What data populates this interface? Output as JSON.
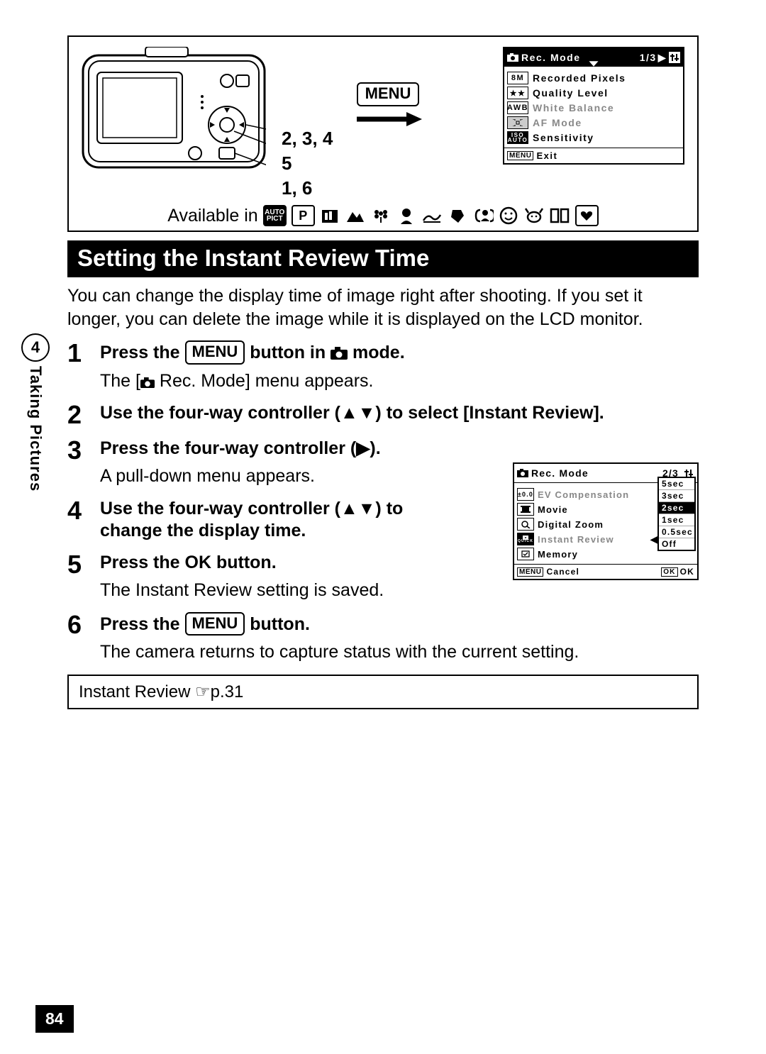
{
  "section": {
    "number": "4",
    "label": "Taking Pictures"
  },
  "pageNumber": "84",
  "figure": {
    "cameraLabels": {
      "l1": "2, 3, 4",
      "l2": "5",
      "l3": "1, 6"
    },
    "menuLabel": "MENU",
    "lcd1": {
      "headerTitle": "Rec. Mode",
      "pageIndicator": "1/3",
      "rows": [
        {
          "icon": "8M",
          "label": "Recorded Pixels"
        },
        {
          "icon": "★★",
          "label": "Quality Level"
        },
        {
          "icon": "AWB",
          "label": "White Balance",
          "gray": true
        },
        {
          "icon": "af",
          "label": "AF Mode",
          "gray": true
        },
        {
          "icon": "ISO AUTO",
          "label": "Sensitivity"
        }
      ],
      "footerBtn": "MENU",
      "footerText": "Exit"
    }
  },
  "availableLabel": "Available in",
  "title": "Setting the Instant Review Time",
  "intro": "You can change the display time of image right after shooting. If you set it longer, you can delete the image while it is displayed on the LCD monitor.",
  "steps": [
    {
      "n": "1",
      "headPre": "Press the ",
      "btn": "MENU",
      "headMid": " button in ",
      "headPost": " mode.",
      "sub": "The [📷 Rec. Mode] menu appears."
    },
    {
      "n": "2",
      "head": "Use the four-way controller (▲▼) to select [Instant Review]."
    },
    {
      "n": "3",
      "head": "Press the four-way controller (▶).",
      "sub": "A pull-down menu appears."
    },
    {
      "n": "4",
      "head": "Use the four-way controller (▲▼) to change the display time."
    },
    {
      "n": "5",
      "headPre": "Press the ",
      "ok": "OK",
      "headPost": " button.",
      "sub": "The Instant Review setting is saved."
    },
    {
      "n": "6",
      "headPre": "Press the ",
      "btn": "MENU",
      "headPost": " button.",
      "sub": "The camera returns to capture status with the current setting."
    }
  ],
  "lcd2": {
    "headerTitle": "Rec. Mode",
    "pageIndicator": "2/3",
    "rows": [
      {
        "icon": "±0.0",
        "label": "EV Compensation",
        "gray": true
      },
      {
        "icon": "mv",
        "label": "Movie"
      },
      {
        "icon": "zm",
        "label": "Digital Zoom"
      },
      {
        "icon": "ir",
        "label": "Instant Review",
        "hl": true
      },
      {
        "icon": "mm",
        "label": "Memory"
      }
    ],
    "dropdown": [
      "5sec",
      "3sec",
      "2sec",
      "1sec",
      "0.5sec",
      "Off"
    ],
    "selected": "2sec",
    "footerBtn": "MENU",
    "footerText": "Cancel",
    "okBox": "OK",
    "okText": "OK"
  },
  "reference": "Instant Review ☞p.31"
}
